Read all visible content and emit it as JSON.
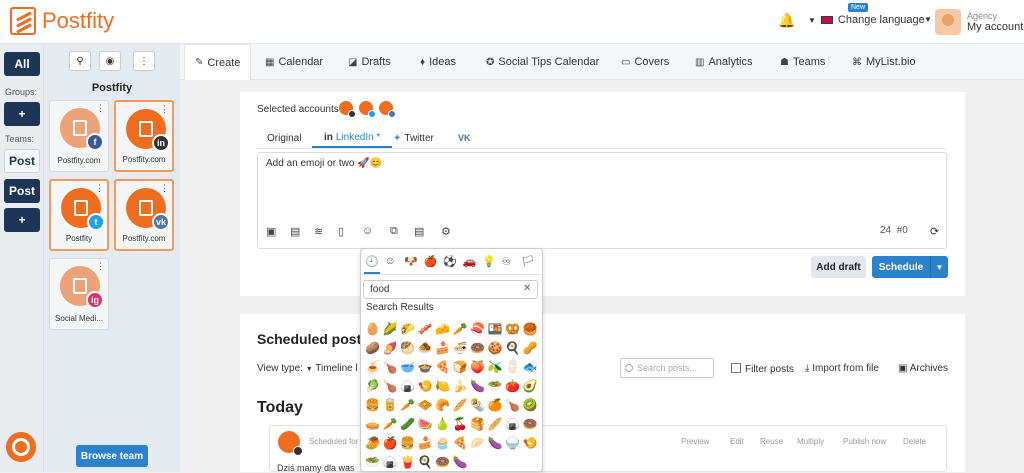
{
  "brand": {
    "name": "Postfity",
    "color": "#f06c1f"
  },
  "topbar": {
    "bell_icon": "bell-icon",
    "language_label": "Change language",
    "account_role": "Agency",
    "account_name": "My account"
  },
  "rail": {
    "all": "All",
    "groups_label": "Groups:",
    "groups_add": "+",
    "teams_label": "Teams:",
    "team1": "Post",
    "team2": "Post",
    "teams_add": "+"
  },
  "panel": {
    "title": "Postfity",
    "browse_team": "Browse team",
    "accounts": [
      {
        "name": "Postfity.com",
        "network": "f",
        "color": "#3b5998",
        "selected": false
      },
      {
        "name": "Postfity.com",
        "network": "in",
        "color": "#333333",
        "selected": true
      },
      {
        "name": "Postfity",
        "network": "t",
        "color": "#1da1f2",
        "selected": true
      },
      {
        "name": "Postfity.com",
        "network": "vk",
        "color": "#4a76a8",
        "selected": true
      },
      {
        "name": "Social Medi...",
        "network": "ig",
        "color": "#e1306c",
        "selected": false
      }
    ]
  },
  "tabs": [
    {
      "label": "Create",
      "icon": "✎"
    },
    {
      "label": "Calendar",
      "icon": "▦"
    },
    {
      "label": "Drafts",
      "icon": "◪"
    },
    {
      "label": "Ideas",
      "icon": "♦"
    },
    {
      "label": "Social Tips Calendar",
      "icon": "✪"
    },
    {
      "label": "Covers",
      "icon": "▭"
    },
    {
      "label": "Analytics",
      "icon": "▥"
    },
    {
      "label": "Teams",
      "icon": "☗"
    },
    {
      "label": "MyList.bio",
      "icon": "⌘"
    }
  ],
  "new_badge": "New",
  "composer": {
    "selected_accounts_label": "Selected accounts:",
    "network_tabs": [
      "Original",
      "LinkedIn *",
      "Twitter",
      "VK"
    ],
    "text": "Add an emoji or two 🚀😊",
    "char_count": "24",
    "hashtag_count": "#0",
    "add_draft": "Add draft",
    "schedule": "Schedule"
  },
  "emoji_picker": {
    "search_value": "food",
    "results_label": "Search Results",
    "categories": [
      "🕘",
      "☺",
      "🐶",
      "🍎",
      "⚽",
      "🚗",
      "💡",
      "♾",
      "🏳"
    ],
    "emojis": [
      "🥚",
      "🌽",
      "🌮",
      "🥓",
      "🧀",
      "🥕",
      "🍣",
      "🍱",
      "🥨",
      "🥮",
      "🥔",
      "🍠",
      "🥙",
      "🧆",
      "🍰",
      "🍜",
      "🍩",
      "🍪",
      "🍳",
      "🥜",
      "🍝",
      "🍗",
      "🥣",
      "🍲",
      "🍕",
      "🍞",
      "🍑",
      "🫒",
      "🥛",
      "🐟",
      "🥬",
      "🍗",
      "🍙",
      "🍤",
      "🍋",
      "🍌",
      "🍆",
      "🥗",
      "🍅",
      "🥑",
      "🍔",
      "🥫",
      "🥕",
      "🧇",
      "🥐",
      "🥖",
      "🌯",
      "🍊",
      "🍗",
      "🥝",
      "🥧",
      "🥕",
      "🥒",
      "🍉",
      "🍐",
      "🍒",
      "🥞",
      "🥖",
      "🍙",
      "🍩",
      "🥭",
      "🍎",
      "🍔",
      "🍰",
      "🧁",
      "🍕",
      "🥟",
      "🍆",
      "🍚",
      "🍤",
      "🥗",
      "🍙",
      "🍟",
      "🍳",
      "🍩",
      "🍆"
    ]
  },
  "scheduled": {
    "title": "Scheduled posts",
    "view_type": "View type:",
    "view_value": "Timeline l",
    "search_placeholder": "Search posts...",
    "filter": "Filter posts",
    "import": "Import from file",
    "archives": "Archives",
    "today": "Today",
    "scheduled_for": "Scheduled for",
    "actions": [
      "Preview",
      "Edit",
      "Reuse",
      "Multiply",
      "Publish now",
      "Delete"
    ],
    "snippet": "Dziś mamy dla was"
  }
}
